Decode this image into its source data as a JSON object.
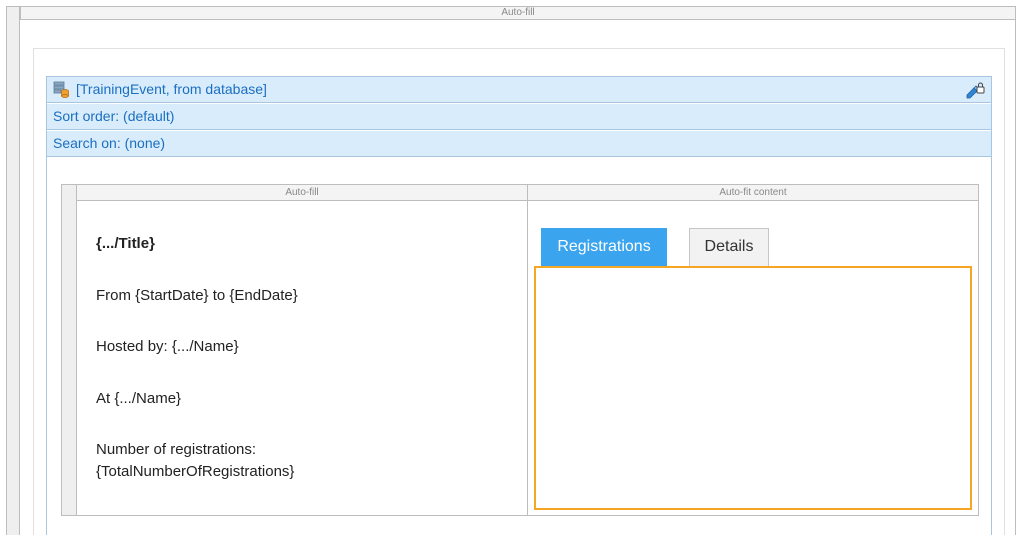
{
  "outer": {
    "header_label": "Auto-fill"
  },
  "list_view": {
    "source_label": "[TrainingEvent, from database]",
    "sort_label": "Sort order: (default)",
    "search_label": "Search on: (none)",
    "icons": {
      "source": "database-icon",
      "action": "lock-edit-icon"
    }
  },
  "inner_table": {
    "columns": [
      "Auto-fill",
      "Auto-fit content"
    ],
    "fields": {
      "title": "{.../Title}",
      "dates": "From {StartDate} to {EndDate}",
      "hosted": "Hosted by: {.../Name}",
      "at": "At {.../Name}",
      "registrations_label": "Number of registrations:",
      "registrations_value": "{TotalNumberOfRegistrations}"
    }
  },
  "tabs": {
    "items": [
      "Registrations",
      "Details"
    ],
    "active_index": 0
  },
  "colors": {
    "tab_active": "#3aa4ee",
    "panel_highlight": "#f5a623",
    "list_row_bg": "#d9ecfb",
    "list_text": "#1a6fc2"
  }
}
